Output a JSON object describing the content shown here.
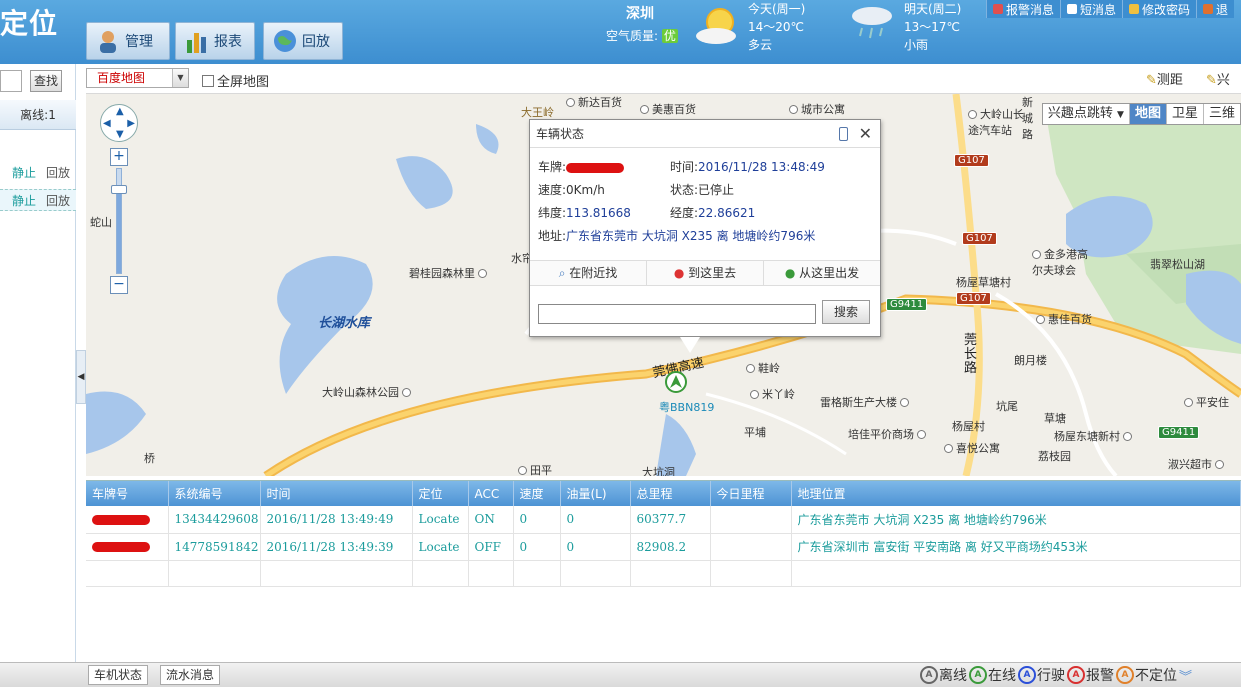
{
  "header": {
    "title": "定位",
    "nav": [
      {
        "label": "管理",
        "icon": "person-icon"
      },
      {
        "label": "报表",
        "icon": "bar-chart-icon"
      },
      {
        "label": "回放",
        "icon": "globe-icon"
      }
    ],
    "city": "深圳",
    "air_quality_label": "空气质量:",
    "air_quality_value": "优",
    "today": {
      "day": "今天(周一)",
      "temp": "14～20℃",
      "desc": "多云"
    },
    "tomorrow": {
      "day": "明天(周二)",
      "temp": "13～17℃",
      "desc": "小雨"
    },
    "links": [
      {
        "label": "报警消息",
        "color": "#e05050"
      },
      {
        "label": "短消息",
        "color": "#ffffff"
      },
      {
        "label": "修改密码",
        "color": "#f0c040"
      },
      {
        "label": "退",
        "color": "#e07030"
      }
    ]
  },
  "left": {
    "search_button": "查找",
    "offline_tab": "离线:1",
    "rows": [
      {
        "status": "静止",
        "playback": "回放"
      },
      {
        "status": "静止",
        "playback": "回放"
      }
    ]
  },
  "toolbar": {
    "map_type": "百度地图",
    "fullscreen": "全屏地图",
    "measure": "测距",
    "poi": "兴"
  },
  "map": {
    "layers": {
      "poi_jump": "兴趣点跳转",
      "map": "地图",
      "satellite": "卫星",
      "three": "三维"
    },
    "labels": {
      "l1": "大王岭",
      "l2": "新达百货",
      "l3": "美惠百货",
      "l4": "城市公寓",
      "l5": "大岭山长途汽车站",
      "l6": "碧桂园森林里",
      "l7": "长湖水库",
      "l8": "大岭山森林公园",
      "l9": "蛇山",
      "l10": "金多港高尔夫球会",
      "l11": "翡翠松山湖",
      "l12": "杨屋草塘村",
      "l13": "惠佳百货",
      "l14": "朗月楼",
      "l15": "莞长路",
      "l16": "鞋岭",
      "l17": "米丫岭",
      "l18": "雷格斯生产大楼",
      "l19": "坑尾",
      "l20": "草塘",
      "l21": "平安住",
      "l22": "杨屋村",
      "l23": "杨屋东塘新村",
      "l24": "培佳平价商场",
      "l25": "喜悦公寓",
      "l26": "荔枝园",
      "l27": "淑兴超市",
      "l28": "平埔",
      "l29": "田平",
      "l30": "大坑洞",
      "l31": "莞佛高速",
      "l32": "新城路",
      "l33": "桥",
      "l34": "水帘"
    },
    "shields": {
      "g107a": "G107",
      "g107b": "G107",
      "g107c": "G107",
      "g9411a": "G9411",
      "g9411b": "G9411"
    },
    "car_label": "粤BBN819",
    "popup": {
      "title": "车辆状态",
      "plate_label": "车牌:",
      "time_label": "时间:",
      "time_value": "2016/11/28 13:48:49",
      "speed_label": "速度:",
      "speed_value": "0Km/h",
      "state_label": "状态:",
      "state_value": "已停止",
      "lat_label": "纬度:",
      "lat_value": "113.81668",
      "lng_label": "经度:",
      "lng_value": "22.86621",
      "addr_label": "地址:",
      "addr_value": "广东省东莞市 大坑洞 X235 离 地塘岭约796米",
      "actions": [
        "在附近找",
        "到这里去",
        "从这里出发"
      ],
      "search_button": "搜索"
    }
  },
  "grid": {
    "columns": [
      "车牌号",
      "系统编号",
      "时间",
      "定位",
      "ACC",
      "速度",
      "油量(L)",
      "总里程",
      "今日里程",
      "地理位置"
    ],
    "rows": [
      {
        "sys": "13434429608",
        "time": "2016/11/28 13:49:49",
        "loc": "Locate",
        "acc": "ON",
        "speed": "0",
        "fuel": "0",
        "total": "60377.7",
        "today": "",
        "addr": "广东省东莞市 大坑洞 X235 离 地塘岭约796米"
      },
      {
        "sys": "14778591842",
        "time": "2016/11/28 13:49:39",
        "loc": "Locate",
        "acc": "OFF",
        "speed": "0",
        "fuel": "0",
        "total": "82908.2",
        "today": "",
        "addr": "广东省深圳市  富安街  平安南路 离 好又平商场约453米"
      }
    ]
  },
  "status": {
    "tabs": [
      "车机状态",
      "流水消息"
    ],
    "legend": [
      {
        "label": "离线",
        "color": "#666666"
      },
      {
        "label": "在线",
        "color": "#3a9a3a"
      },
      {
        "label": "行驶",
        "color": "#2b4fd8"
      },
      {
        "label": "报警",
        "color": "#d83030"
      },
      {
        "label": "不定位",
        "color": "#e0802a"
      }
    ]
  }
}
